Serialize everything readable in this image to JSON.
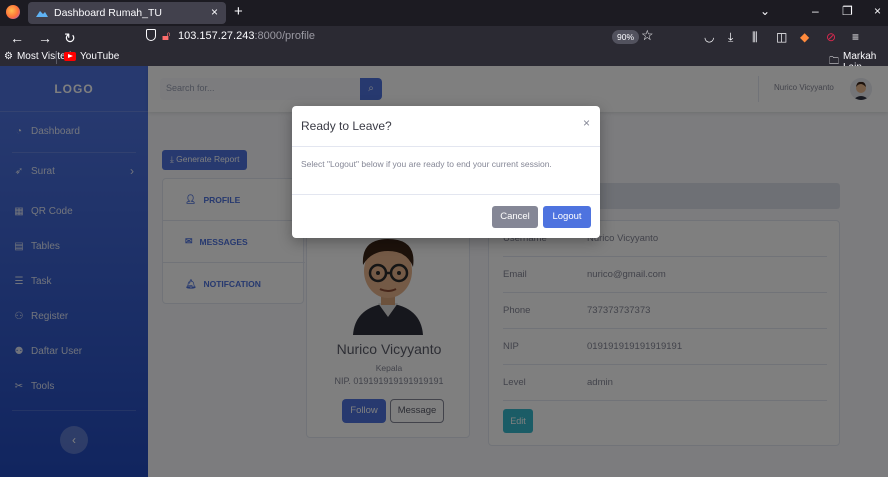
{
  "browser": {
    "tab_title": "Dashboard Rumah_TU",
    "tab_close": "×",
    "new_tab": "+",
    "window_controls": {
      "minimize": "–",
      "restore": "❐",
      "close": "×"
    },
    "url_host": "103.157.27.243",
    "url_rest": ":8000/profile",
    "zoom": "90%",
    "bookmarks": {
      "most_visited": "Most Visited",
      "youtube": "YouTube",
      "other": "Markah Lain"
    }
  },
  "sidebar": {
    "logo": "LOGO",
    "items": [
      {
        "label": "Dashboard",
        "icon": "tachometer-icon"
      },
      {
        "label": "Surat",
        "icon": "paper-plane-icon"
      },
      {
        "label": "QR Code",
        "icon": "qrcode-icon"
      },
      {
        "label": "Tables",
        "icon": "table-icon"
      },
      {
        "label": "Task",
        "icon": "list-icon"
      },
      {
        "label": "Register",
        "icon": "user-plus-icon"
      },
      {
        "label": "Daftar User",
        "icon": "users-icon"
      },
      {
        "label": "Tools",
        "icon": "tools-icon"
      }
    ]
  },
  "topbar": {
    "search_placeholder": "Search for...",
    "user_name": "Nurico Vicyyanto"
  },
  "actions": {
    "generate_report": "Generate Report"
  },
  "menu": {
    "items": [
      {
        "label": "PROFILE",
        "icon": "user-icon"
      },
      {
        "label": "MESSAGES",
        "icon": "envelope-icon"
      },
      {
        "label": "NOTIFCATION",
        "icon": "bell-icon"
      }
    ]
  },
  "profile": {
    "name": "Nurico Vicyyanto",
    "role": "Kepala",
    "nip": "NIP. 019191919191919191",
    "follow_label": "Follow",
    "message_label": "Message"
  },
  "details": {
    "rows": [
      {
        "label": "Username",
        "value": "Nurico Vicyyanto"
      },
      {
        "label": "Email",
        "value": "nurico@gmail.com"
      },
      {
        "label": "Phone",
        "value": "737373737373"
      },
      {
        "label": "NIP",
        "value": "019191919191919191"
      },
      {
        "label": "Level",
        "value": "admin"
      }
    ],
    "edit_label": "Edit"
  },
  "modal": {
    "title": "Ready to Leave?",
    "close": "×",
    "body": "Select \"Logout\" below if you are ready to end your current session.",
    "cancel_label": "Cancel",
    "logout_label": "Logout"
  },
  "colors": {
    "primary": "#4e73df",
    "secondary": "#858796",
    "info": "#36b9cc",
    "browser_bg": "#1c1b22"
  }
}
